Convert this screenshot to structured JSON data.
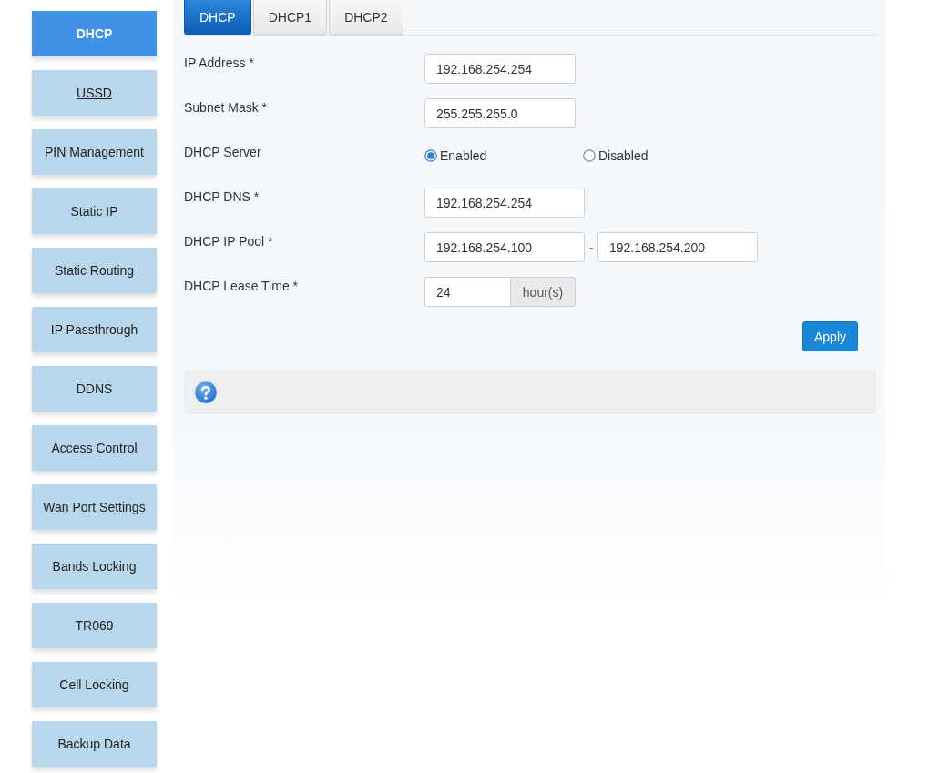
{
  "sidebar": {
    "items": [
      {
        "label": "DHCP",
        "selected": true,
        "underlined": false
      },
      {
        "label": "USSD",
        "selected": false,
        "underlined": true
      },
      {
        "label": "PIN Management",
        "selected": false,
        "underlined": false
      },
      {
        "label": "Static IP",
        "selected": false,
        "underlined": false
      },
      {
        "label": "Static Routing",
        "selected": false,
        "underlined": false
      },
      {
        "label": "IP Passthrough",
        "selected": false,
        "underlined": false
      },
      {
        "label": "DDNS",
        "selected": false,
        "underlined": false
      },
      {
        "label": "Access Control",
        "selected": false,
        "underlined": false
      },
      {
        "label": "Wan Port Settings",
        "selected": false,
        "underlined": false
      },
      {
        "label": "Bands Locking",
        "selected": false,
        "underlined": false
      },
      {
        "label": "TR069",
        "selected": false,
        "underlined": false
      },
      {
        "label": "Cell Locking",
        "selected": false,
        "underlined": false
      },
      {
        "label": "Backup Data",
        "selected": false,
        "underlined": false
      }
    ]
  },
  "tabs": [
    {
      "label": "DHCP",
      "selected": true
    },
    {
      "label": "DHCP1",
      "selected": false
    },
    {
      "label": "DHCP2",
      "selected": false
    }
  ],
  "form": {
    "fields": [
      {
        "kind": "text",
        "label": "IP Address *",
        "value": "192.168.254.254"
      },
      {
        "kind": "text",
        "label": "Subnet Mask *",
        "value": "255.255.255.0"
      },
      {
        "kind": "radio",
        "label": "DHCP Server",
        "options": [
          {
            "label": "Enabled",
            "selected": true
          },
          {
            "label": "Disabled",
            "selected": false
          }
        ]
      },
      {
        "kind": "text",
        "label": "DHCP DNS *",
        "value": "192.168.254.254"
      },
      {
        "kind": "range",
        "label": "DHCP IP Pool *",
        "from": "192.168.254.100",
        "separator": "-",
        "to": "192.168.254.200"
      },
      {
        "kind": "unit",
        "label": "DHCP Lease Time *",
        "value": "24",
        "unit": "hour(s)"
      }
    ]
  },
  "apply_button": "Apply"
}
